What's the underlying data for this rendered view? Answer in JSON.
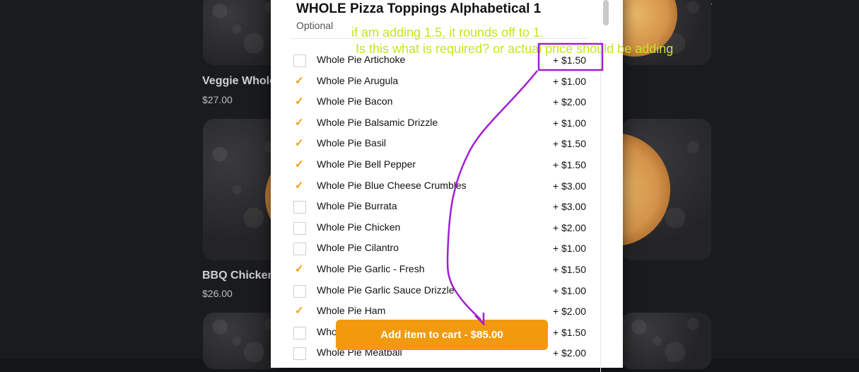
{
  "background": {
    "back_icon": "arrow-left-icon",
    "menu_icon": "hamburger-icon",
    "cards": [
      {
        "title": "Veggie Whole",
        "price": "$27.00"
      },
      {
        "title": "BBQ Chicken",
        "price": "$26.00"
      }
    ]
  },
  "modal": {
    "title": "WHOLE Pizza Toppings Alphabetical 1",
    "subtitle": "Optional",
    "items": [
      {
        "label": "Whole Pie Artichoke",
        "price": "+ $1.50",
        "checked": false
      },
      {
        "label": "Whole Pie Arugula",
        "price": "+ $1.00",
        "checked": true
      },
      {
        "label": "Whole Pie Bacon",
        "price": "+ $2.00",
        "checked": true
      },
      {
        "label": "Whole Pie Balsamic Drizzle",
        "price": "+ $1.00",
        "checked": true
      },
      {
        "label": "Whole Pie Basil",
        "price": "+ $1.50",
        "checked": true
      },
      {
        "label": "Whole Pie Bell Pepper",
        "price": "+ $1.50",
        "checked": true
      },
      {
        "label": "Whole Pie Blue Cheese Crumbles",
        "price": "+ $3.00",
        "checked": true
      },
      {
        "label": "Whole Pie Burrata",
        "price": "+ $3.00",
        "checked": false
      },
      {
        "label": "Whole Pie Chicken",
        "price": "+ $2.00",
        "checked": false
      },
      {
        "label": "Whole Pie Cilantro",
        "price": "+ $1.00",
        "checked": false
      },
      {
        "label": "Whole Pie Garlic - Fresh",
        "price": "+ $1.50",
        "checked": true
      },
      {
        "label": "Whole Pie Garlic Sauce Drizzle",
        "price": "+ $1.00",
        "checked": false
      },
      {
        "label": "Whole Pie Ham",
        "price": "+ $2.00",
        "checked": true
      },
      {
        "label": "Who",
        "price": "+ $1.50",
        "checked": false
      },
      {
        "label": "Whole Pie Meatball",
        "price": "+ $2.00",
        "checked": false
      }
    ],
    "cart_button": "Add item to cart - $85.00"
  },
  "annotation": {
    "line1": "if am adding 1.5, it rounds off to 1.",
    "line2": "Is this what is required? or actual price should be adding",
    "color": "#a020d0",
    "text_color": "#c8e41e"
  }
}
